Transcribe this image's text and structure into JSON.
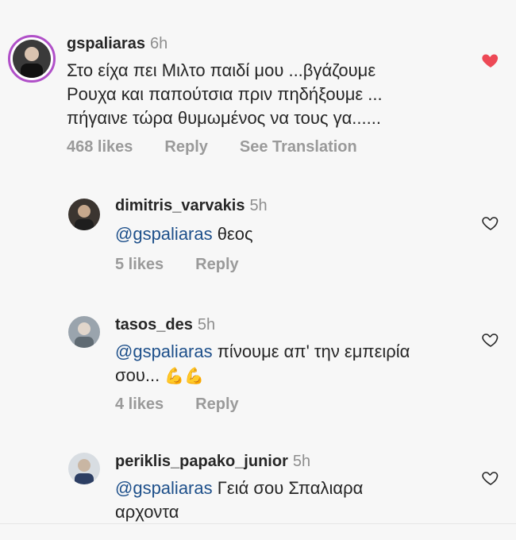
{
  "comments": [
    {
      "username": "gspaliaras",
      "time": "6h",
      "text_lines": [
        "Στο είχα πει Μιλτο παιδί μου ...βγάζουμε",
        "Ρουχα και παπούτσια πριν πηδήξουμε ...",
        "πήγαινε τώρα θυμωμένος να τους γα......"
      ],
      "likes": "468 likes",
      "reply": "Reply",
      "translate": "See Translation",
      "liked": true
    },
    {
      "username": "dimitris_varvakis",
      "time": "5h",
      "mention": "@gspaliaras",
      "text": "θεος",
      "likes": "5 likes",
      "reply": "Reply",
      "liked": false
    },
    {
      "username": "tasos_des",
      "time": "5h",
      "mention": "@gspaliaras",
      "text_line1": "πίνουμε απ' την εμπειρία",
      "text_line2": "σου...",
      "emoji": "💪💪",
      "likes": "4 likes",
      "reply": "Reply",
      "liked": false
    },
    {
      "username": "periklis_papako_junior",
      "time": "5h",
      "mention": "@gspaliaras",
      "text_line1": "Γειά σου Σπαλιαρα",
      "text_line2": "αρχοντα",
      "liked": false
    }
  ],
  "colors": {
    "heart_filled": "#ed4956",
    "mention": "#1d4f8a",
    "muted": "#8e8e8e"
  }
}
